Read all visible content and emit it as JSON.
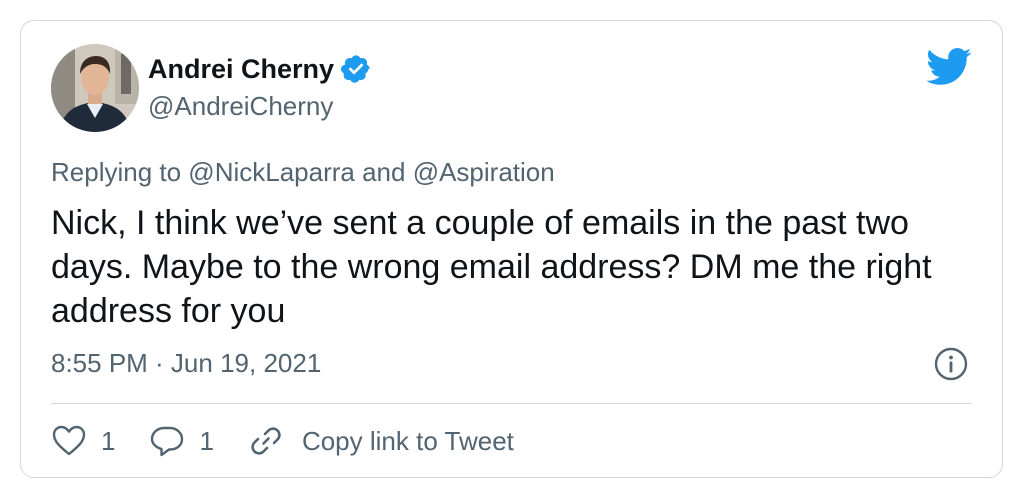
{
  "author": {
    "display_name": "Andrei Cherny",
    "handle": "@AndreiCherny",
    "verified": true,
    "avatar_icon": "profile-photo"
  },
  "brand": {
    "icon": "twitter-bird-icon",
    "color": "#1d9bf0"
  },
  "tweet": {
    "replying_to": "Replying to @NickLaparra and @Aspiration",
    "text": "Nick, I think we’ve sent a couple of emails in the past two days. Maybe to the wrong email address? DM me the right address for you",
    "timestamp": "8:55 PM · Jun 19, 2021"
  },
  "actions": {
    "like_count": "1",
    "reply_count": "1",
    "copy_link_label": "Copy link to Tweet"
  },
  "colors": {
    "text_primary": "#0f1419",
    "text_secondary": "#536471",
    "border": "#cfd9de",
    "accent": "#1d9bf0"
  }
}
